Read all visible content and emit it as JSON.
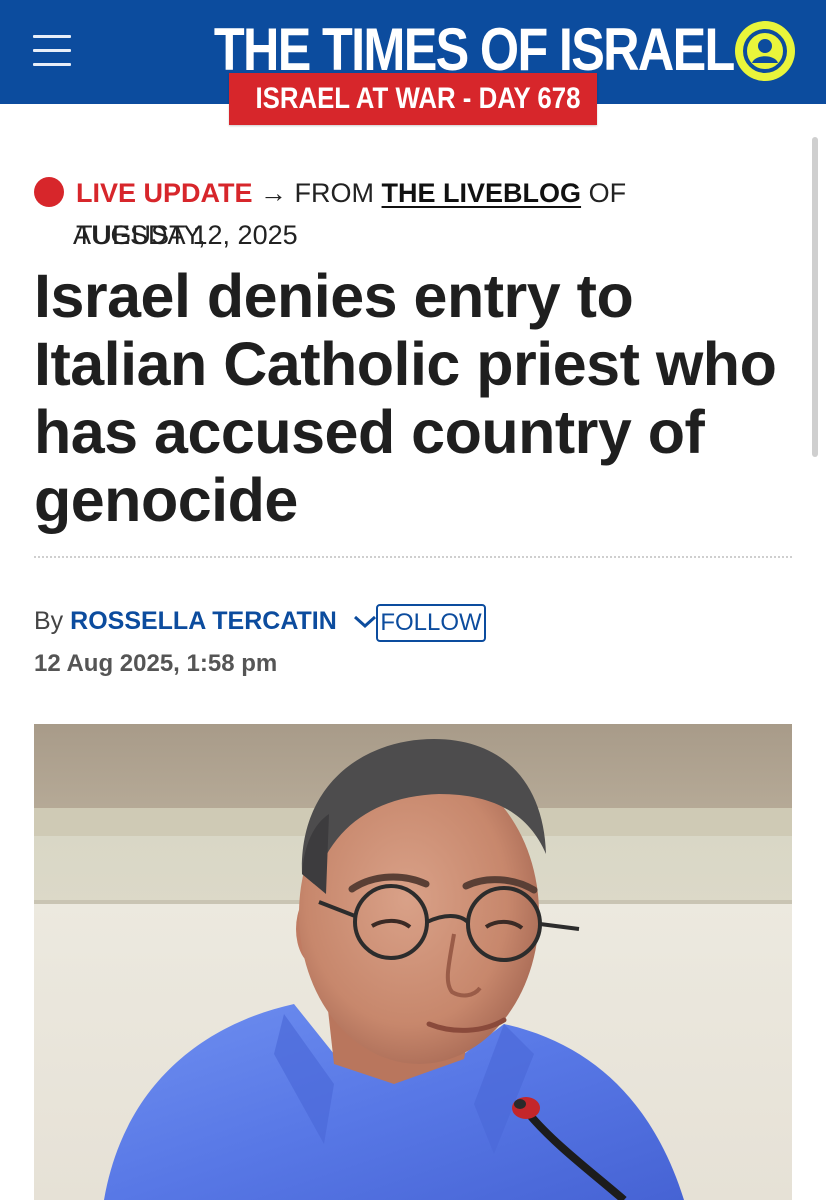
{
  "header": {
    "site_title": "THE TIMES OF ISRAEL",
    "war_banner": "ISRAEL AT WAR - DAY 678",
    "menu_icon": "hamburger-menu-icon",
    "account_icon": "user-account-icon",
    "colors": {
      "brand_blue": "#0c4c9e",
      "banner_red": "#d7262b",
      "account_yellow": "#e9f53b"
    }
  },
  "live_update": {
    "label": "LIVE UPDATE",
    "arrow": "→",
    "from_text": "FROM",
    "liveblog_link": "THE LIVEBLOG",
    "of_text": "OF TUESDAY,",
    "date": "AUGUST 12, 2025"
  },
  "article": {
    "headline": "Israel denies entry to Italian Catholic priest who has accused country of genocide",
    "by_label": "By",
    "author": "ROSSELLA TERCATIN",
    "follow_label": "FOLLOW",
    "published": "12 Aug 2025, 1:58 pm",
    "image_alt": "Man with glasses in a blue shirt speaking into a microphone"
  }
}
